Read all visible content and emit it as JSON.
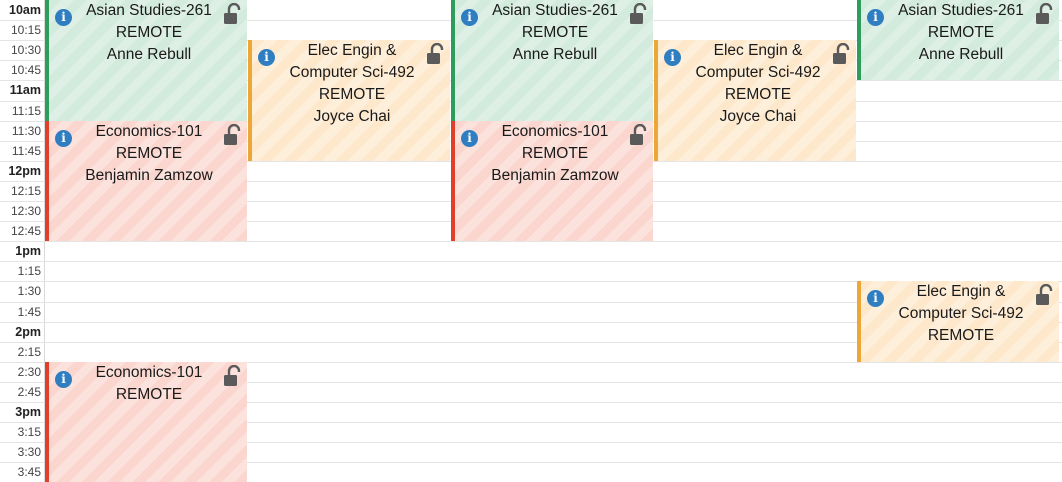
{
  "time_labels": [
    {
      "label": "10am",
      "hour": true
    },
    {
      "label": "10:15",
      "hour": false
    },
    {
      "label": "10:30",
      "hour": false
    },
    {
      "label": "10:45",
      "hour": false
    },
    {
      "label": "11am",
      "hour": true
    },
    {
      "label": "11:15",
      "hour": false
    },
    {
      "label": "11:30",
      "hour": false
    },
    {
      "label": "11:45",
      "hour": false
    },
    {
      "label": "12pm",
      "hour": true
    },
    {
      "label": "12:15",
      "hour": false
    },
    {
      "label": "12:30",
      "hour": false
    },
    {
      "label": "12:45",
      "hour": false
    },
    {
      "label": "1pm",
      "hour": true
    },
    {
      "label": "1:15",
      "hour": false
    },
    {
      "label": "1:30",
      "hour": false
    },
    {
      "label": "1:45",
      "hour": false
    },
    {
      "label": "2pm",
      "hour": true
    },
    {
      "label": "2:15",
      "hour": false
    },
    {
      "label": "2:30",
      "hour": false
    },
    {
      "label": "2:45",
      "hour": false
    },
    {
      "label": "3pm",
      "hour": true
    },
    {
      "label": "3:15",
      "hour": false
    },
    {
      "label": "3:30",
      "hour": false
    },
    {
      "label": "3:45",
      "hour": false
    }
  ],
  "events": [
    {
      "course": "econ",
      "day": 0,
      "start": "11:30",
      "end": "1:00",
      "lines": [
        "Economics-101",
        "REMOTE",
        "Benjamin Zamzow"
      ]
    },
    {
      "course": "asian",
      "day": 0,
      "start": "10:00",
      "end": "11:30",
      "lines": [
        "Asian Studies-261",
        "REMOTE",
        "Anne Rebull"
      ]
    },
    {
      "course": "econ",
      "day": 0,
      "start": "2:30",
      "end": "4:00",
      "lines": [
        "Economics-101",
        "REMOTE"
      ]
    },
    {
      "course": "elec",
      "day": 1,
      "start": "10:30",
      "end": "12:00",
      "lines": [
        "Elec Engin &",
        "Computer Sci-492",
        "REMOTE",
        "Joyce Chai"
      ]
    },
    {
      "course": "econ",
      "day": 2,
      "start": "11:30",
      "end": "1:00",
      "lines": [
        "Economics-101",
        "REMOTE",
        "Benjamin Zamzow"
      ]
    },
    {
      "course": "asian",
      "day": 2,
      "start": "10:00",
      "end": "11:30",
      "lines": [
        "Asian Studies-261",
        "REMOTE",
        "Anne Rebull"
      ]
    },
    {
      "course": "elec",
      "day": 3,
      "start": "10:30",
      "end": "12:00",
      "lines": [
        "Elec Engin &",
        "Computer Sci-492",
        "REMOTE",
        "Joyce Chai"
      ]
    },
    {
      "course": "asian",
      "day": 4,
      "start": "10:00",
      "end": "11:00",
      "lines": [
        "Asian Studies-261",
        "REMOTE",
        "Anne Rebull"
      ]
    },
    {
      "course": "elec",
      "day": 4,
      "start": "1:30",
      "end": "2:30",
      "lines": [
        "Elec Engin &",
        "Computer Sci-492",
        "REMOTE"
      ]
    }
  ],
  "icons": {
    "info": "info-icon",
    "lock": "unlocked-padlock-icon",
    "info_glyph": "i"
  },
  "colors": {
    "econ": "#e0402a",
    "asian": "#2e9c5a",
    "elec": "#eba838",
    "info": "#2f7ec1",
    "lock": "#5a5a5a"
  }
}
